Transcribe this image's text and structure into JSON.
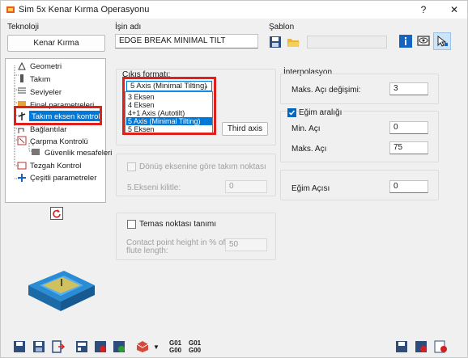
{
  "window": {
    "title": "Sim 5x Kenar Kırma Operasyonu",
    "help": "?",
    "close": "✕"
  },
  "technology": {
    "label": "Teknoloji",
    "button": "Kenar Kırma"
  },
  "job_name": {
    "label": "İşin adı",
    "value": "EDGE BREAK MINIMAL TILT"
  },
  "template": {
    "label": "Şablon"
  },
  "tree": {
    "items": [
      "Geometri",
      "Takım",
      "Seviyeler",
      "Final parametreleri",
      "Takım eksen kontrolü",
      "Bağlantılar",
      "Çarpma Kontrolü",
      "Güvenlik mesafeleri",
      "Tezgah Kontrol",
      "Çeşitli parametreler"
    ]
  },
  "output_format": {
    "label": "Çıkış formatı:",
    "selected": "5 Axis (Minimal Tilting)",
    "options": [
      "3 Eksen",
      "4 Eksen",
      "4+1 Axis (Autotilt)",
      "5 Axis (Minimal Tilting)",
      "5 Eksen"
    ],
    "selected_index": 3
  },
  "third_axis_button": "Third axis",
  "rotation": {
    "checkbox_label": "Dönüş eksenine göre takım noktası",
    "lock_label": "5.Ekseni kilitle:",
    "lock_value": "0"
  },
  "contact": {
    "checkbox_label": "Temas noktası tanımı",
    "height_label_1": "Contact point height in % of",
    "height_label_2": "flute length:",
    "height_value": "50"
  },
  "interpolation": {
    "label": "İnterpolasyon",
    "max_angle_change_label": "Maks. Açı değişimi:",
    "max_angle_change_value": "3",
    "tilt_range_label": "Eğim aralığı",
    "tilt_range_checked": true,
    "min_angle_label": "Min. Açı",
    "min_angle_value": "0",
    "max_angle_label": "Maks. Açı",
    "max_angle_value": "75",
    "tilt_angle_label": "Eğim Açısı",
    "tilt_angle_value": "0"
  },
  "bottom": {
    "g01": "G01",
    "g00": "G00",
    "g01b": "G01",
    "g00b": "G00"
  },
  "colors": {
    "highlight": "#e0201c",
    "selection": "#0078d7",
    "checkbox": "#0067c0"
  }
}
